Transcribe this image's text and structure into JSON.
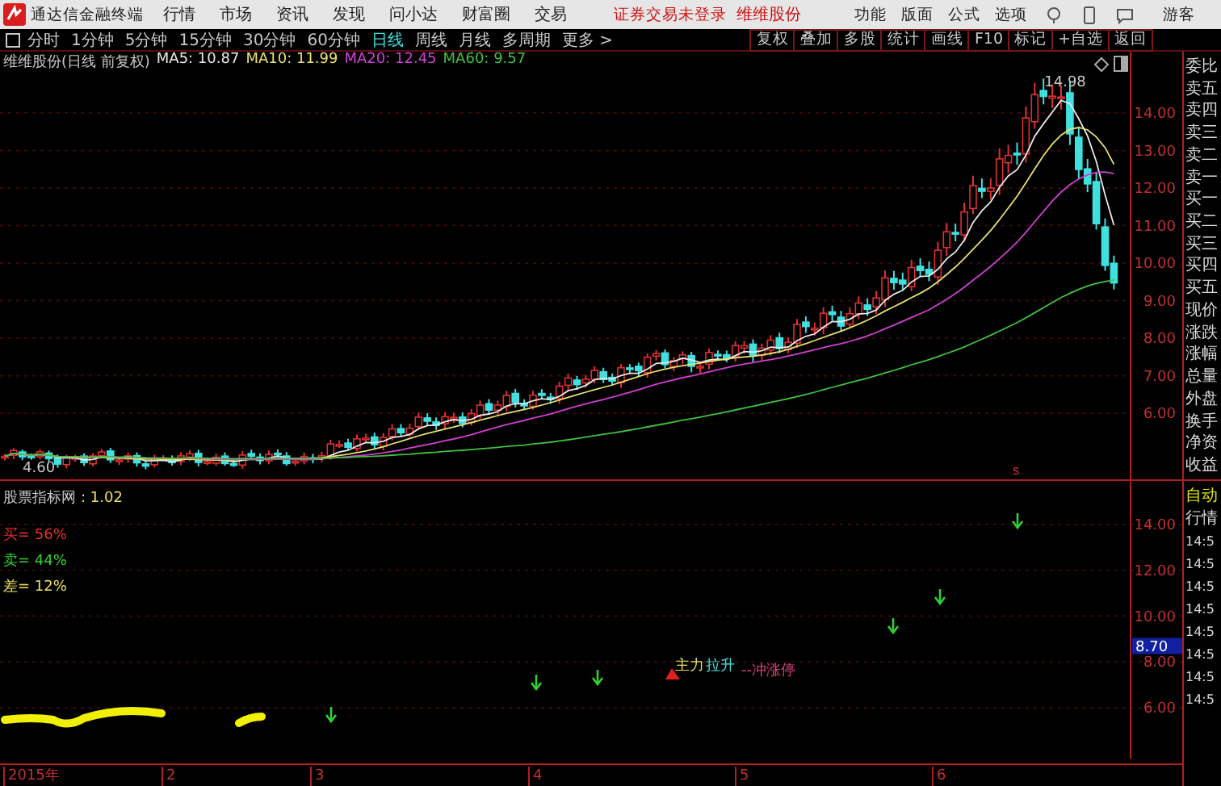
{
  "app": {
    "title": "通达信金融终端",
    "menu": [
      "行情",
      "市场",
      "资讯",
      "发现",
      "问小达",
      "财富圈",
      "交易"
    ],
    "login_status": "证券交易未登录",
    "stock_link": "维维股份",
    "tools": [
      "功能",
      "版面",
      "公式",
      "选项"
    ],
    "user": "游客"
  },
  "periods": [
    {
      "label": "分时",
      "selected": false
    },
    {
      "label": "1分钟",
      "selected": false
    },
    {
      "label": "5分钟",
      "selected": false
    },
    {
      "label": "15分钟",
      "selected": false
    },
    {
      "label": "30分钟",
      "selected": false
    },
    {
      "label": "60分钟",
      "selected": false
    },
    {
      "label": "日线",
      "selected": true
    },
    {
      "label": "周线",
      "selected": false
    },
    {
      "label": "月线",
      "selected": false
    },
    {
      "label": "多周期",
      "selected": false
    },
    {
      "label": "更多 >",
      "selected": false
    }
  ],
  "chart_tools": [
    "复权",
    "叠加",
    "多股",
    "统计",
    "画线",
    "F10",
    "标记",
    "+自选",
    "返回"
  ],
  "main_chart": {
    "title": "维维股份(日线 前复权)",
    "ma": [
      {
        "label": "MA5: 10.87",
        "color": "#e8e8e8"
      },
      {
        "label": "MA10: 11.99",
        "color": "#e8e070"
      },
      {
        "label": "MA20: 12.45",
        "color": "#d040d0"
      },
      {
        "label": "MA60: 9.57",
        "color": "#40c040"
      }
    ],
    "high_label": "14.98",
    "low_label": "4.60",
    "price_ticks": [
      "14.00",
      "13.00",
      "12.00",
      "11.00",
      "10.00",
      "9.00",
      "8.00",
      "7.00",
      "6.00"
    ],
    "signal_mark": "s"
  },
  "indicator": {
    "name": "股票指标网",
    "value": ": 1.02",
    "stats": [
      {
        "label": "买= 56%",
        "color": "#e03030"
      },
      {
        "label": "卖= 44%",
        "color": "#30d030"
      },
      {
        "label": "差= 12%",
        "color": "#e8e060"
      }
    ],
    "ticks": [
      "14.00",
      "12.00",
      "10.00",
      "8.00",
      "6.00"
    ],
    "current": "8.70",
    "annotation": {
      "main": "主力",
      "rise": "拉升",
      "target": "--冲涨停"
    }
  },
  "x_axis": [
    "2015年",
    "2",
    "3",
    "4",
    "5",
    "6"
  ],
  "quote_panel": {
    "labels": [
      "委比",
      "卖五",
      "卖四",
      "卖三",
      "卖二",
      "卖一",
      "买一",
      "买二",
      "买三",
      "买四",
      "买五",
      "现价",
      "涨跌",
      "涨幅",
      "总量",
      "外盘",
      "换手",
      "净资",
      "收益"
    ],
    "mode": "自动",
    "tab": "行情",
    "times": [
      "14:5",
      "14:5",
      "14:5",
      "14:5",
      "14:5",
      "14:5",
      "14:5",
      "14:5"
    ]
  }
}
